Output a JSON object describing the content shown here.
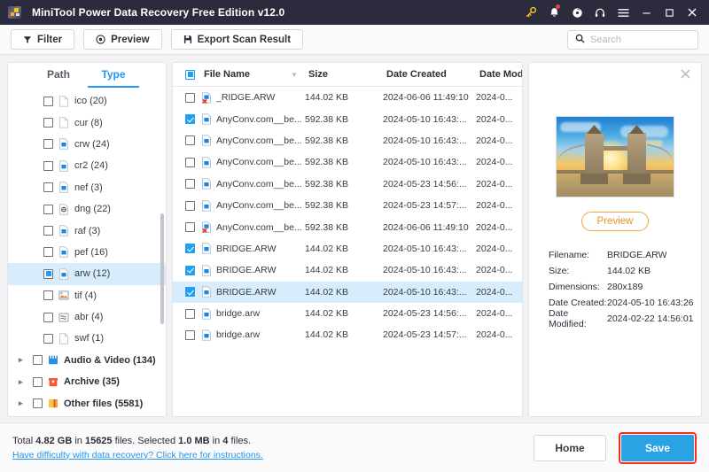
{
  "window": {
    "title": "MiniTool Power Data Recovery Free Edition v12.0",
    "logo_icon": "minitool-logo-icon",
    "icons": [
      {
        "name": "key-icon",
        "glyph": "key"
      },
      {
        "name": "bell-icon",
        "glyph": "bell",
        "badge": true
      },
      {
        "name": "disc-icon",
        "glyph": "disc"
      },
      {
        "name": "headphones-icon",
        "glyph": "headphones"
      },
      {
        "name": "menu-icon",
        "glyph": "hamburger"
      }
    ],
    "controls": [
      {
        "name": "minimize-button",
        "glyph": "minimize"
      },
      {
        "name": "maximize-button",
        "glyph": "maximize"
      },
      {
        "name": "close-button",
        "glyph": "close"
      }
    ]
  },
  "toolbar": {
    "filter_label": "Filter",
    "preview_label": "Preview",
    "export_label": "Export Scan Result",
    "search_placeholder": "Search",
    "search_value": ""
  },
  "sidebar": {
    "tabs": [
      {
        "label": "Path",
        "active": false
      },
      {
        "label": "Type",
        "active": true
      }
    ],
    "items": [
      {
        "label": "ico (20)",
        "icon": "file-blank-icon",
        "checked": "none",
        "selected": false,
        "group": false
      },
      {
        "label": "cur (8)",
        "icon": "file-blank-icon",
        "checked": "none",
        "selected": false,
        "group": false
      },
      {
        "label": "crw (24)",
        "icon": "file-image-icon",
        "checked": "none",
        "selected": false,
        "group": false
      },
      {
        "label": "cr2 (24)",
        "icon": "file-image-icon",
        "checked": "none",
        "selected": false,
        "group": false
      },
      {
        "label": "nef (3)",
        "icon": "file-image-icon",
        "checked": "none",
        "selected": false,
        "group": false
      },
      {
        "label": "dng (22)",
        "icon": "file-gear-icon",
        "checked": "none",
        "selected": false,
        "group": false
      },
      {
        "label": "raf (3)",
        "icon": "file-image-icon",
        "checked": "none",
        "selected": false,
        "group": false
      },
      {
        "label": "pef (16)",
        "icon": "file-image-icon",
        "checked": "none",
        "selected": false,
        "group": false
      },
      {
        "label": "arw (12)",
        "icon": "file-image-icon",
        "checked": "partial",
        "selected": true,
        "group": false
      },
      {
        "label": "tif (4)",
        "icon": "file-picture-icon",
        "checked": "none",
        "selected": false,
        "group": false
      },
      {
        "label": "abr (4)",
        "icon": "file-brush-icon",
        "checked": "none",
        "selected": false,
        "group": false
      },
      {
        "label": "swf (1)",
        "icon": "file-blank-icon",
        "checked": "none",
        "selected": false,
        "group": false
      },
      {
        "label": "Audio & Video (134)",
        "icon": "folder-video-icon",
        "checked": "none",
        "selected": false,
        "group": true
      },
      {
        "label": "Archive (35)",
        "icon": "folder-archive-icon",
        "checked": "none",
        "selected": false,
        "group": true
      },
      {
        "label": "Other files (5581)",
        "icon": "folder-other-icon",
        "checked": "none",
        "selected": false,
        "group": true
      }
    ]
  },
  "filelist": {
    "columns": [
      "File Name",
      "Size",
      "Date Created",
      "Date Modifie"
    ],
    "header_checkbox": "partial",
    "sort_icon": "sort-descending-icon",
    "rows": [
      {
        "name": "_RIDGE.ARW",
        "size": "144.02 KB",
        "created": "2024-06-06 11:49:10",
        "modified": "2024-0...",
        "checked": false,
        "selected": false,
        "icon": "file-broken-icon"
      },
      {
        "name": "AnyConv.com__be...",
        "size": "592.38 KB",
        "created": "2024-05-10 16:43:...",
        "modified": "2024-0...",
        "checked": true,
        "selected": false,
        "icon": "file-image-icon"
      },
      {
        "name": "AnyConv.com__be...",
        "size": "592.38 KB",
        "created": "2024-05-10 16:43:...",
        "modified": "2024-0...",
        "checked": false,
        "selected": false,
        "icon": "file-image-icon"
      },
      {
        "name": "AnyConv.com__be...",
        "size": "592.38 KB",
        "created": "2024-05-10 16:43:...",
        "modified": "2024-0...",
        "checked": false,
        "selected": false,
        "icon": "file-image-icon"
      },
      {
        "name": "AnyConv.com__be...",
        "size": "592.38 KB",
        "created": "2024-05-23 14:56:...",
        "modified": "2024-0...",
        "checked": false,
        "selected": false,
        "icon": "file-image-icon"
      },
      {
        "name": "AnyConv.com__be...",
        "size": "592.38 KB",
        "created": "2024-05-23 14:57:...",
        "modified": "2024-0...",
        "checked": false,
        "selected": false,
        "icon": "file-image-icon"
      },
      {
        "name": "AnyConv.com__be...",
        "size": "592.38 KB",
        "created": "2024-06-06 11:49:10",
        "modified": "2024-0...",
        "checked": false,
        "selected": false,
        "icon": "file-broken-icon"
      },
      {
        "name": "BRIDGE.ARW",
        "size": "144.02 KB",
        "created": "2024-05-10 16:43:...",
        "modified": "2024-0...",
        "checked": true,
        "selected": false,
        "icon": "file-image-icon"
      },
      {
        "name": "BRIDGE.ARW",
        "size": "144.02 KB",
        "created": "2024-05-10 16:43:...",
        "modified": "2024-0...",
        "checked": true,
        "selected": false,
        "icon": "file-image-icon"
      },
      {
        "name": "BRIDGE.ARW",
        "size": "144.02 KB",
        "created": "2024-05-10 16:43:...",
        "modified": "2024-0...",
        "checked": true,
        "selected": true,
        "icon": "file-image-icon"
      },
      {
        "name": "bridge.arw",
        "size": "144.02 KB",
        "created": "2024-05-23 14:56:...",
        "modified": "2024-0...",
        "checked": false,
        "selected": false,
        "icon": "file-image-icon"
      },
      {
        "name": "bridge.arw",
        "size": "144.02 KB",
        "created": "2024-05-23 14:57:...",
        "modified": "2024-0...",
        "checked": false,
        "selected": false,
        "icon": "file-image-icon"
      }
    ]
  },
  "preview": {
    "close_icon": "close-icon",
    "thumbnail_alt": "tower-bridge-sunset-thumbnail",
    "preview_button": "Preview",
    "meta": [
      {
        "label": "Filename:",
        "value": "BRIDGE.ARW"
      },
      {
        "label": "Size:",
        "value": "144.02 KB"
      },
      {
        "label": "Dimensions:",
        "value": "280x189"
      },
      {
        "label": "Date Created:",
        "value": "2024-05-10 16:43:26"
      },
      {
        "label": "Date Modified:",
        "value": "2024-02-22 14:56:01"
      }
    ]
  },
  "footer": {
    "total_prefix": "Total ",
    "total_size": "4.82 GB",
    "total_mid": " in ",
    "total_files": "15625",
    "total_suffix": " files.  Selected ",
    "selected_size": "1.0 MB",
    "selected_mid": " in ",
    "selected_files": "4",
    "selected_suffix": " files.",
    "help_link": "Have difficulty with data recovery? Click here for instructions.",
    "home_label": "Home",
    "save_label": "Save"
  },
  "colors": {
    "titlebar": "#2b2b3d",
    "accent": "#2196f3",
    "save_button": "#29a3e3",
    "save_highlight": "#ff2a1f",
    "selection": "#d7edfb",
    "preview_button": "#ef8f25"
  }
}
